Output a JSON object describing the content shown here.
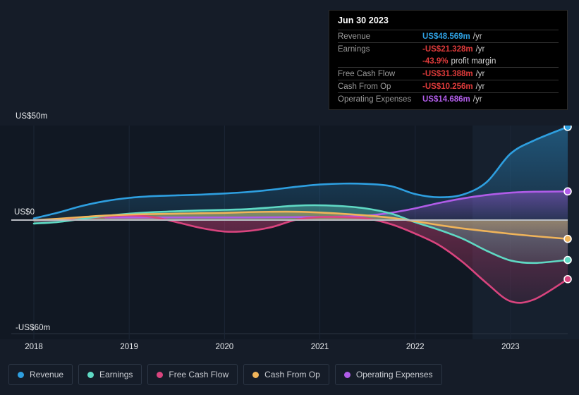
{
  "tooltip": {
    "title": "Jun 30 2023",
    "rows": [
      {
        "label": "Revenue",
        "value": "US$48.569m",
        "unit": "/yr",
        "color": "#2e9fe0"
      },
      {
        "label": "Earnings",
        "value": "-US$21.328m",
        "unit": "/yr",
        "color": "#e03b3b"
      },
      {
        "label": "",
        "value": "-43.9%",
        "sub": "profit margin",
        "color": "#e03b3b"
      },
      {
        "label": "Free Cash Flow",
        "value": "-US$31.388m",
        "unit": "/yr",
        "color": "#e03b3b"
      },
      {
        "label": "Cash From Op",
        "value": "-US$10.256m",
        "unit": "/yr",
        "color": "#e03b3b"
      },
      {
        "label": "Operating Expenses",
        "value": "US$14.686m",
        "unit": "/yr",
        "color": "#b05ce8"
      }
    ]
  },
  "axes": {
    "y_top_label": "US$50m",
    "y_zero_label": "US$0",
    "y_bottom_label": "-US$60m",
    "x_labels": [
      "2018",
      "2019",
      "2020",
      "2021",
      "2022",
      "2023"
    ]
  },
  "legend": [
    {
      "label": "Revenue",
      "color": "#2e9fe0"
    },
    {
      "label": "Earnings",
      "color": "#5fd9c4"
    },
    {
      "label": "Free Cash Flow",
      "color": "#d9447e"
    },
    {
      "label": "Cash From Op",
      "color": "#f0b45a"
    },
    {
      "label": "Operating Expenses",
      "color": "#b05ce8"
    }
  ],
  "chart_data": {
    "type": "area",
    "title": "",
    "xlabel": "",
    "ylabel": "US$",
    "ylim": [
      -60,
      50
    ],
    "xlim": [
      2018.0,
      2023.6
    ],
    "grid": true,
    "legend_position": "bottom",
    "yticks": [
      50,
      0,
      -60
    ],
    "ytick_labels": [
      "US$50m",
      "US$0",
      "-US$60m"
    ],
    "xticks": [
      2018,
      2019,
      2020,
      2021,
      2022,
      2023
    ],
    "forecast_start": 2022.6,
    "annotation": "Jun 30 2023 values shown in tooltip",
    "x": [
      2018.0,
      2018.25,
      2018.5,
      2018.75,
      2019.0,
      2019.25,
      2019.5,
      2019.75,
      2020.0,
      2020.25,
      2020.5,
      2020.75,
      2021.0,
      2021.25,
      2021.5,
      2021.75,
      2022.0,
      2022.25,
      2022.5,
      2022.75,
      2023.0,
      2023.25,
      2023.6
    ],
    "series": [
      {
        "name": "Revenue",
        "color": "#2e9fe0",
        "values": [
          0.5,
          3.5,
          7.0,
          9.6,
          11.3,
          12.2,
          12.6,
          13.0,
          13.6,
          14.4,
          15.6,
          17.1,
          18.3,
          18.8,
          18.6,
          17.4,
          13.3,
          11.6,
          13.0,
          19.6,
          34.5,
          41.5,
          48.569
        ]
      },
      {
        "name": "Earnings",
        "color": "#5fd9c4",
        "values": [
          -2.2,
          -1.4,
          0.2,
          1.8,
          3.0,
          3.8,
          4.3,
          4.7,
          5.0,
          5.4,
          6.3,
          7.2,
          7.4,
          6.9,
          5.6,
          3.0,
          -1.5,
          -5.5,
          -10.2,
          -16.5,
          -21.6,
          -22.9,
          -21.328
        ]
      },
      {
        "name": "Free Cash Flow",
        "color": "#d9447e",
        "values": [
          -0.5,
          -0.3,
          0.4,
          1.4,
          2.0,
          1.2,
          -1.5,
          -4.5,
          -6.4,
          -6.1,
          -4.0,
          -0.2,
          1.2,
          1.2,
          0.4,
          -2.6,
          -7.5,
          -13.5,
          -22.5,
          -33.5,
          -43.0,
          -42.0,
          -31.388
        ]
      },
      {
        "name": "Cash From Op",
        "color": "#f0b45a",
        "values": [
          -0.4,
          0.3,
          1.2,
          2.0,
          2.5,
          2.8,
          3.0,
          3.2,
          3.4,
          3.8,
          4.0,
          4.0,
          3.6,
          2.9,
          2.0,
          0.8,
          -1.0,
          -3.0,
          -4.8,
          -6.2,
          -7.6,
          -8.8,
          -10.256
        ]
      },
      {
        "name": "Operating Expenses",
        "color": "#b05ce8",
        "values": [
          null,
          null,
          null,
          1.0,
          1.0,
          1.0,
          1.0,
          1.0,
          1.0,
          1.0,
          1.1,
          1.2,
          1.3,
          1.5,
          2.0,
          3.5,
          5.8,
          8.6,
          11.0,
          12.8,
          14.0,
          14.5,
          14.686
        ]
      }
    ]
  }
}
